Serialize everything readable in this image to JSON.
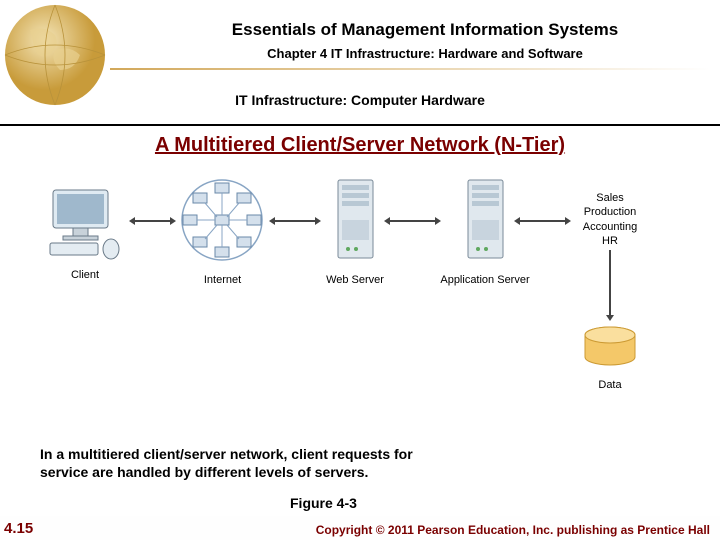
{
  "header": {
    "title": "Essentials of Management Information Systems",
    "chapter": "Chapter 4 IT Infrastructure: Hardware and Software",
    "subhead": "IT Infrastructure: Computer Hardware"
  },
  "section_title": "A Multitiered Client/Server Network (N-Tier)",
  "diagram": {
    "nodes": {
      "client": "Client",
      "internet": "Internet",
      "web": "Web Server",
      "app": "Application Server",
      "data": "Data"
    },
    "app_list": [
      "Sales",
      "Production",
      "Accounting",
      "HR"
    ]
  },
  "caption": "In a multitiered client/server network, client requests for service are handled by different levels of servers.",
  "figure_ref": "Figure 4-3",
  "slide_number": "4.15",
  "copyright": "Copyright © 2011 Pearson Education, Inc. publishing as Prentice Hall"
}
